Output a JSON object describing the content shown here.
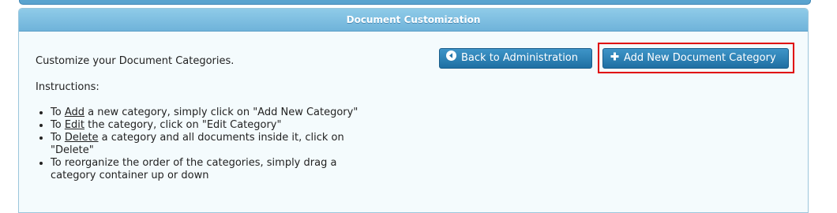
{
  "panel": {
    "title": "Document Customization"
  },
  "content": {
    "intro": "Customize your Document Categories.",
    "instructions_label": "Instructions:",
    "instructions": [
      {
        "pre": "To ",
        "link": "Add",
        "post": " a new category, simply click on \"Add New Category\""
      },
      {
        "pre": "To ",
        "link": "Edit",
        "post": " the category, click on \"Edit Category\""
      },
      {
        "pre": "To ",
        "link": "Delete",
        "post": " a category and all documents inside it, click on \"Delete\""
      },
      {
        "pre": "To reorganize the order of the categories, simply drag a category container up or down",
        "link": "",
        "post": ""
      }
    ]
  },
  "buttons": {
    "back": {
      "label": "Back to Administration",
      "icon": "circle-left-arrow-icon"
    },
    "add": {
      "label": "Add New Document Category",
      "icon": "plus-icon"
    }
  },
  "colors": {
    "header_blue": "#7ac0e2",
    "button_blue": "#2b80b6",
    "highlight_red": "#e00000",
    "panel_bg": "#f4fbfd"
  }
}
